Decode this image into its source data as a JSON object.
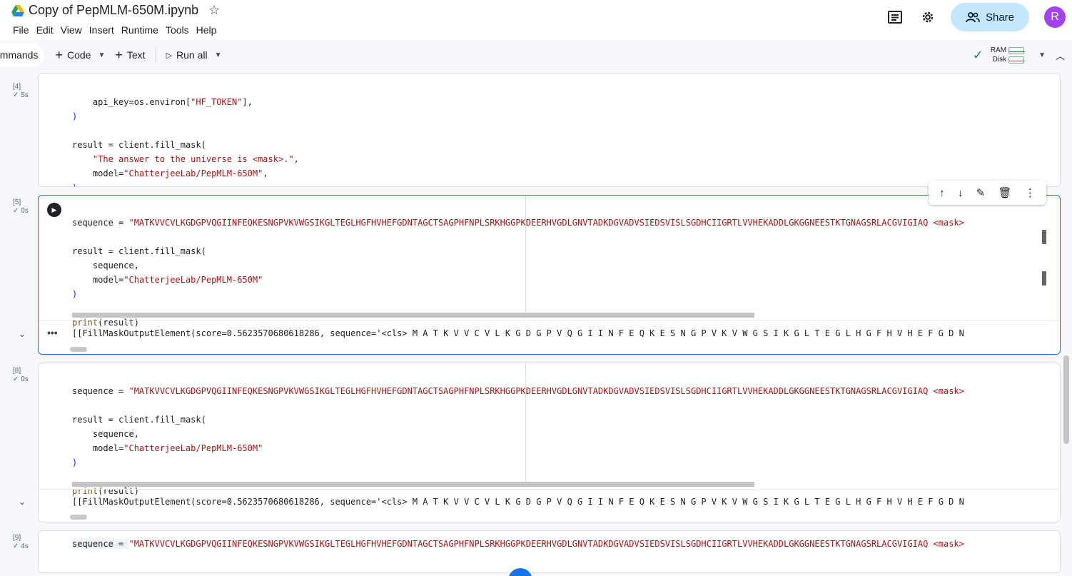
{
  "header": {
    "doc_title": "Copy of PepMLM-650M.ipynb",
    "menu": [
      "File",
      "Edit",
      "View",
      "Insert",
      "Runtime",
      "Tools",
      "Help"
    ],
    "share_label": "Share",
    "avatar_letter": "R"
  },
  "toolbar": {
    "commands_label": "ommands",
    "code_label": "Code",
    "text_label": "Text",
    "run_all_label": "Run all",
    "ram_label": "RAM",
    "disk_label": "Disk"
  },
  "cells": [
    {
      "exec_count": "[4]",
      "time": "5s",
      "lines": {
        "l1": "    api_key=os.environ[",
        "l1s": "\"HF_TOKEN\"",
        "l1e": "],",
        "l2": ")",
        "l4a": "result = client.fill_mask(",
        "l5": "    \"The answer to the universe is <mask>.\",",
        "l6a": "    model=",
        "l6s": "\"ChatterjeeLab/PepMLM-650M\"",
        "l6e": ",",
        "l7": ")"
      }
    },
    {
      "exec_count": "[5]",
      "time": "0s",
      "seq_prefix": "sequence = ",
      "seq_value": "\"MATKVVCVLKGDGPVQGIINFEQKESNGPVKVWGSIKGLTEGLHGFHVHEFGDNTAGCTSAGPHFNPLSRKHGGPKDEERHVGDLGNVTADKDGVADVSIEDSVISLSGDHCIIGRTLVVHEKADDLGKGGNEESTKTGNAGSRLACGVIGIAQ <mask>",
      "result_line": "result = client.fill_mask(",
      "arg1": "    sequence,",
      "arg2a": "    model=",
      "arg2s": "\"ChatterjeeLab/PepMLM-650M\"",
      "close": ")",
      "print_fn": "print",
      "print_arg": "(result)",
      "output": "[[FillMaskOutputElement(score=0.5623570680618286, sequence='<cls> M A T K V V C V L K G D G P V Q G I I N F E Q K E S N G P V K V W G S I K G L T E G L H G F H V H E F G D N"
    },
    {
      "exec_count": "[8]",
      "time": "0s",
      "seq_prefix": "sequence = ",
      "seq_value": "\"MATKVVCVLKGDGPVQGIINFEQKESNGPVKVWGSIKGLTEGLHGFHVHEFGDNTAGCTSAGPHFNPLSRKHGGPKDEERHVGDLGNVTADKDGVADVSIEDSVISLSGDHCIIGRTLVVHEKADDLGKGGNEESTKTGNAGSRLACGVIGIAQ <mask>",
      "result_line": "result = client.fill_mask(",
      "arg1": "    sequence,",
      "arg2a": "    model=",
      "arg2s": "\"ChatterjeeLab/PepMLM-650M\"",
      "close": ")",
      "print_fn": "print",
      "print_arg": "(result)",
      "output": "[[FillMaskOutputElement(score=0.5623570680618286, sequence='<cls> M A T K V V C V L K G D G P V Q G I I N F E Q K E S N G P V K V W G S I K G L T E G L H G F H V H E F G D N"
    },
    {
      "exec_count": "[9]",
      "time": "4s",
      "seq_prefix": "sequence = ",
      "seq_value": "\"MATKVVCVLKGDGPVQGIINFEQKESNGPVKVWGSIKGLTEGLHGFHVHEFGDNTAGCTSAGPHFNPLSRKHGGPKDEERHVGDLGNVTADKDGVADVSIEDSVISLSGDHCIIGRTLVVHEKADDLGKGGNEESTKTGNAGSRLACGVIGIAQ <mask>"
    }
  ],
  "check_mark": "✓",
  "colors": {
    "accent": "#1a73e8",
    "string": "#a31515",
    "ok": "#1e8e3e"
  }
}
